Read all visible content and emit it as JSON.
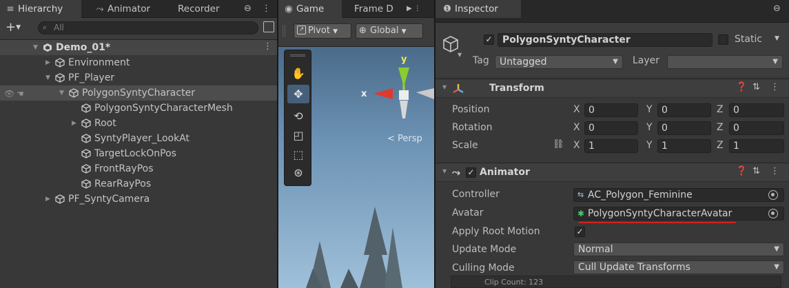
{
  "hierarchy": {
    "tabs": [
      {
        "label": "Hierarchy",
        "icon": "list-icon"
      },
      {
        "label": "Animator",
        "icon": "animator-icon"
      },
      {
        "label": "Recorder",
        "icon": ""
      }
    ],
    "search_placeholder": "All",
    "rows": [
      {
        "label": "Demo_01*",
        "indent": 0,
        "arrow": "expanded",
        "kind": "scene"
      },
      {
        "label": "Environment",
        "indent": 1,
        "arrow": "collapsed",
        "kind": "object"
      },
      {
        "label": "PF_Player",
        "indent": 1,
        "arrow": "expanded",
        "kind": "object"
      },
      {
        "label": "PolygonSyntyCharacter",
        "indent": 2,
        "arrow": "expanded",
        "kind": "object",
        "selected": true
      },
      {
        "label": "PolygonSyntyCharacterMesh",
        "indent": 3,
        "arrow": "none",
        "kind": "object"
      },
      {
        "label": "Root",
        "indent": 3,
        "arrow": "collapsed",
        "kind": "object"
      },
      {
        "label": "SyntyPlayer_LookAt",
        "indent": 3,
        "arrow": "none",
        "kind": "object"
      },
      {
        "label": "TargetLockOnPos",
        "indent": 3,
        "arrow": "none",
        "kind": "object"
      },
      {
        "label": "FrontRayPos",
        "indent": 3,
        "arrow": "none",
        "kind": "object"
      },
      {
        "label": "RearRayPos",
        "indent": 3,
        "arrow": "none",
        "kind": "object"
      },
      {
        "label": "PF_SyntyCamera",
        "indent": 1,
        "arrow": "collapsed",
        "kind": "object"
      }
    ]
  },
  "scene": {
    "tabs": [
      {
        "label": "Game"
      },
      {
        "label": "Frame D"
      }
    ],
    "pivot_label": "Pivot",
    "global_label": "Global",
    "gizmo_y": "y",
    "gizmo_x": "x",
    "persp_label": "< Persp"
  },
  "inspector": {
    "tab_label": "Inspector",
    "object_name": "PolygonSyntyCharacter",
    "static_label": "Static",
    "tag_label": "Tag",
    "tag_value": "Untagged",
    "layer_label": "Layer",
    "layer_value": "",
    "transform": {
      "title": "Transform",
      "rows": [
        {
          "label": "Position",
          "x": "0",
          "y": "0",
          "z": "0"
        },
        {
          "label": "Rotation",
          "x": "0",
          "y": "0",
          "z": "0"
        },
        {
          "label": "Scale",
          "x": "1",
          "y": "1",
          "z": "1"
        }
      ]
    },
    "animator": {
      "title": "Animator",
      "controller_label": "Controller",
      "controller_value": "AC_Polygon_Feminine",
      "avatar_label": "Avatar",
      "avatar_value": "PolygonSyntyCharacterAvatar",
      "apply_root_label": "Apply Root Motion",
      "update_mode_label": "Update Mode",
      "update_mode_value": "Normal",
      "culling_mode_label": "Culling Mode",
      "culling_mode_value": "Cull Update Transforms",
      "clip_count": "Clip Count: 123"
    },
    "axis": {
      "x": "X",
      "y": "Y",
      "z": "Z"
    }
  },
  "colors": {
    "selection": "#4d4d4d",
    "accent_blue": "#46607c",
    "underline_red": "#d42020",
    "sky": "#6d93b5"
  }
}
